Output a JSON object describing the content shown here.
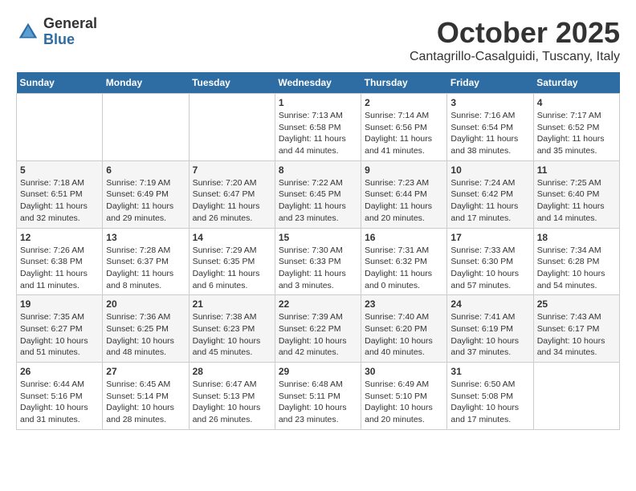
{
  "header": {
    "logo_general": "General",
    "logo_blue": "Blue",
    "month_title": "October 2025",
    "location": "Cantagrillo-Casalguidi, Tuscany, Italy"
  },
  "days_of_week": [
    "Sunday",
    "Monday",
    "Tuesday",
    "Wednesday",
    "Thursday",
    "Friday",
    "Saturday"
  ],
  "weeks": [
    {
      "days": [
        {
          "number": "",
          "info": ""
        },
        {
          "number": "",
          "info": ""
        },
        {
          "number": "",
          "info": ""
        },
        {
          "number": "1",
          "info": "Sunrise: 7:13 AM\nSunset: 6:58 PM\nDaylight: 11 hours and 44 minutes."
        },
        {
          "number": "2",
          "info": "Sunrise: 7:14 AM\nSunset: 6:56 PM\nDaylight: 11 hours and 41 minutes."
        },
        {
          "number": "3",
          "info": "Sunrise: 7:16 AM\nSunset: 6:54 PM\nDaylight: 11 hours and 38 minutes."
        },
        {
          "number": "4",
          "info": "Sunrise: 7:17 AM\nSunset: 6:52 PM\nDaylight: 11 hours and 35 minutes."
        }
      ]
    },
    {
      "days": [
        {
          "number": "5",
          "info": "Sunrise: 7:18 AM\nSunset: 6:51 PM\nDaylight: 11 hours and 32 minutes."
        },
        {
          "number": "6",
          "info": "Sunrise: 7:19 AM\nSunset: 6:49 PM\nDaylight: 11 hours and 29 minutes."
        },
        {
          "number": "7",
          "info": "Sunrise: 7:20 AM\nSunset: 6:47 PM\nDaylight: 11 hours and 26 minutes."
        },
        {
          "number": "8",
          "info": "Sunrise: 7:22 AM\nSunset: 6:45 PM\nDaylight: 11 hours and 23 minutes."
        },
        {
          "number": "9",
          "info": "Sunrise: 7:23 AM\nSunset: 6:44 PM\nDaylight: 11 hours and 20 minutes."
        },
        {
          "number": "10",
          "info": "Sunrise: 7:24 AM\nSunset: 6:42 PM\nDaylight: 11 hours and 17 minutes."
        },
        {
          "number": "11",
          "info": "Sunrise: 7:25 AM\nSunset: 6:40 PM\nDaylight: 11 hours and 14 minutes."
        }
      ]
    },
    {
      "days": [
        {
          "number": "12",
          "info": "Sunrise: 7:26 AM\nSunset: 6:38 PM\nDaylight: 11 hours and 11 minutes."
        },
        {
          "number": "13",
          "info": "Sunrise: 7:28 AM\nSunset: 6:37 PM\nDaylight: 11 hours and 8 minutes."
        },
        {
          "number": "14",
          "info": "Sunrise: 7:29 AM\nSunset: 6:35 PM\nDaylight: 11 hours and 6 minutes."
        },
        {
          "number": "15",
          "info": "Sunrise: 7:30 AM\nSunset: 6:33 PM\nDaylight: 11 hours and 3 minutes."
        },
        {
          "number": "16",
          "info": "Sunrise: 7:31 AM\nSunset: 6:32 PM\nDaylight: 11 hours and 0 minutes."
        },
        {
          "number": "17",
          "info": "Sunrise: 7:33 AM\nSunset: 6:30 PM\nDaylight: 10 hours and 57 minutes."
        },
        {
          "number": "18",
          "info": "Sunrise: 7:34 AM\nSunset: 6:28 PM\nDaylight: 10 hours and 54 minutes."
        }
      ]
    },
    {
      "days": [
        {
          "number": "19",
          "info": "Sunrise: 7:35 AM\nSunset: 6:27 PM\nDaylight: 10 hours and 51 minutes."
        },
        {
          "number": "20",
          "info": "Sunrise: 7:36 AM\nSunset: 6:25 PM\nDaylight: 10 hours and 48 minutes."
        },
        {
          "number": "21",
          "info": "Sunrise: 7:38 AM\nSunset: 6:23 PM\nDaylight: 10 hours and 45 minutes."
        },
        {
          "number": "22",
          "info": "Sunrise: 7:39 AM\nSunset: 6:22 PM\nDaylight: 10 hours and 42 minutes."
        },
        {
          "number": "23",
          "info": "Sunrise: 7:40 AM\nSunset: 6:20 PM\nDaylight: 10 hours and 40 minutes."
        },
        {
          "number": "24",
          "info": "Sunrise: 7:41 AM\nSunset: 6:19 PM\nDaylight: 10 hours and 37 minutes."
        },
        {
          "number": "25",
          "info": "Sunrise: 7:43 AM\nSunset: 6:17 PM\nDaylight: 10 hours and 34 minutes."
        }
      ]
    },
    {
      "days": [
        {
          "number": "26",
          "info": "Sunrise: 6:44 AM\nSunset: 5:16 PM\nDaylight: 10 hours and 31 minutes."
        },
        {
          "number": "27",
          "info": "Sunrise: 6:45 AM\nSunset: 5:14 PM\nDaylight: 10 hours and 28 minutes."
        },
        {
          "number": "28",
          "info": "Sunrise: 6:47 AM\nSunset: 5:13 PM\nDaylight: 10 hours and 26 minutes."
        },
        {
          "number": "29",
          "info": "Sunrise: 6:48 AM\nSunset: 5:11 PM\nDaylight: 10 hours and 23 minutes."
        },
        {
          "number": "30",
          "info": "Sunrise: 6:49 AM\nSunset: 5:10 PM\nDaylight: 10 hours and 20 minutes."
        },
        {
          "number": "31",
          "info": "Sunrise: 6:50 AM\nSunset: 5:08 PM\nDaylight: 10 hours and 17 minutes."
        },
        {
          "number": "",
          "info": ""
        }
      ]
    }
  ]
}
